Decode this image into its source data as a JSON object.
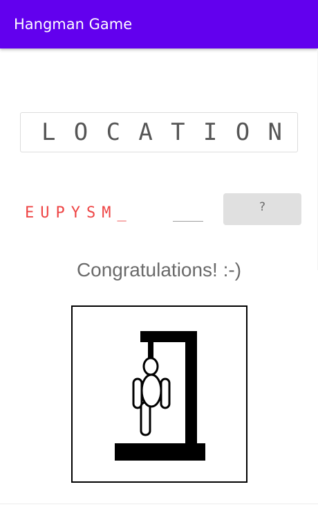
{
  "app_bar": {
    "title": "Hangman Game",
    "color": "#6200ee"
  },
  "word": {
    "letters": [
      "L",
      "O",
      "C",
      "A",
      "T",
      "I",
      "O",
      "N"
    ]
  },
  "guess": {
    "wrong_letters": "EUPYSM_",
    "input_value": "",
    "button_label": "?",
    "wrong_color": "#ee4444"
  },
  "status": {
    "message": "Congratulations! :-)"
  },
  "hangman": {
    "icon": "hangman-drawing"
  }
}
